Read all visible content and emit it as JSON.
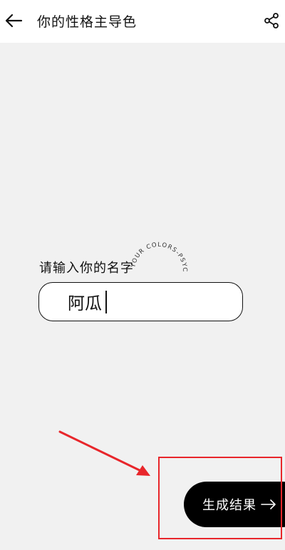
{
  "header": {
    "title": "你的性格主导色",
    "back_icon": "arrow-left-icon",
    "share_icon": "share-icon"
  },
  "form": {
    "label": "请输入你的名字",
    "name_value": "阿瓜",
    "circle_text": "YOUR COLORS-PSYC"
  },
  "action": {
    "result_label": "生成结果",
    "arrow_icon": "arrow-right-icon"
  },
  "annotation": {
    "color": "#e8262b"
  },
  "colors": {
    "background": "#f1f1f1",
    "header": "#ffffff",
    "button": "#000000",
    "text": "#111111"
  }
}
